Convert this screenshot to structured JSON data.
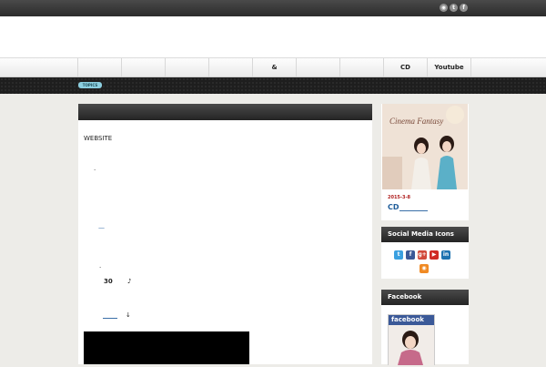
{
  "top_bar": {
    "icons": [
      {
        "name": "rss-icon",
        "glyph": "◉"
      },
      {
        "name": "twitter-icon",
        "glyph": "t"
      },
      {
        "name": "facebook-icon",
        "glyph": "f"
      }
    ]
  },
  "nav": {
    "items": [
      "",
      "",
      "",
      "",
      "&",
      "",
      "",
      "CD",
      "Youtube"
    ]
  },
  "strip": {
    "badge": "TOPICS"
  },
  "main": {
    "website_label": "WEBSITE",
    "dot_1": "·",
    "dash": "—",
    "dot_2": "·",
    "number": "30",
    "note_glyph": "♪",
    "arrow": "↓"
  },
  "sidebar": {
    "promo": {
      "image_text": "Cinema Fantasy",
      "date": "2015-3-8",
      "title": "CD"
    },
    "social_widget": {
      "title": "Social Media Icons",
      "icons": [
        {
          "name": "twitter-icon",
          "glyph": "t",
          "color": "#3aa0e0"
        },
        {
          "name": "facebook-icon",
          "glyph": "f",
          "color": "#3b5998"
        },
        {
          "name": "google-plus-icon",
          "glyph": "g+",
          "color": "#d24a3c"
        },
        {
          "name": "youtube-icon",
          "glyph": "▶",
          "color": "#d02b25"
        },
        {
          "name": "linkedin-icon",
          "glyph": "in",
          "color": "#1f73b0"
        },
        {
          "name": "rss-icon",
          "glyph": "◉",
          "color": "#f08a24"
        }
      ]
    },
    "facebook_widget": {
      "title": "Facebook",
      "box_label": "facebook"
    }
  }
}
